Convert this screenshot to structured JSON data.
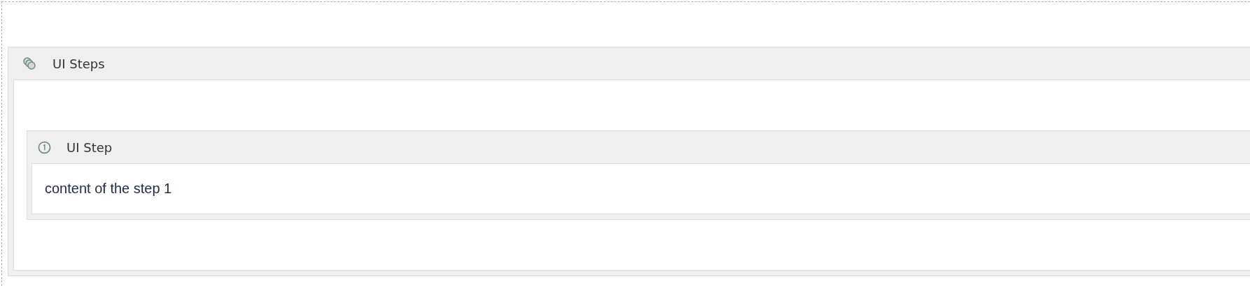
{
  "panel": {
    "title": "UI Steps",
    "steps": [
      {
        "title": "UI Step",
        "content": "content of the step 1"
      }
    ]
  }
}
